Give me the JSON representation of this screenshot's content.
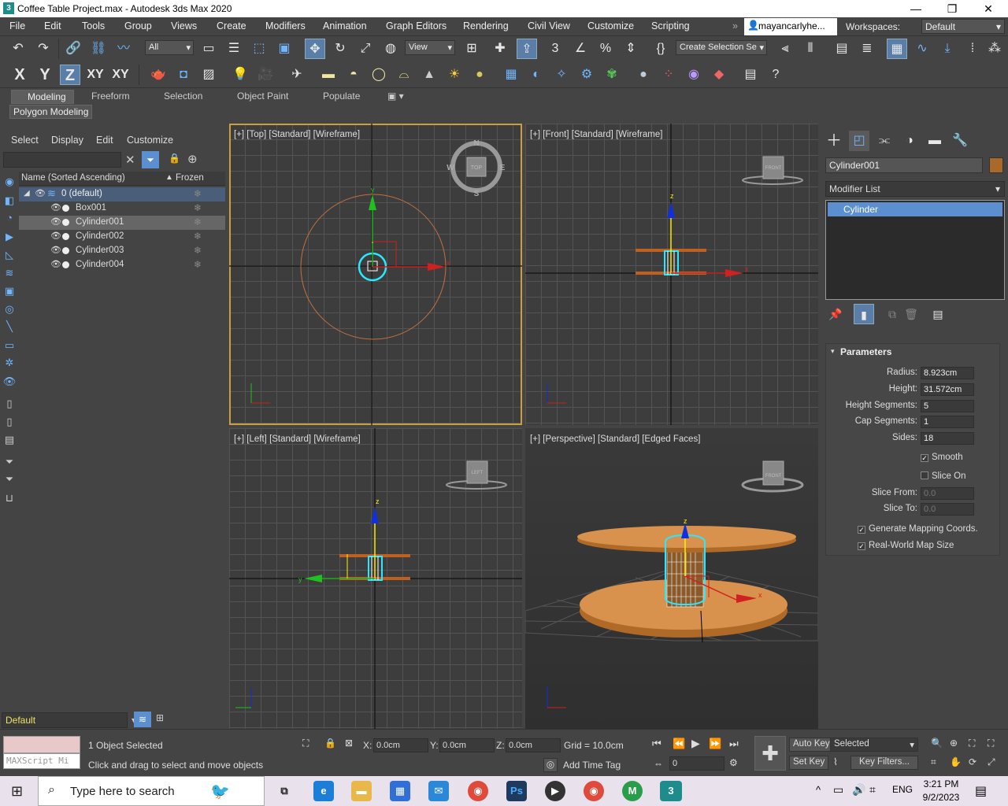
{
  "window": {
    "title": "Coffee Table Project.max - Autodesk 3ds Max 2020",
    "app_icon": "3"
  },
  "menu": [
    "File",
    "Edit",
    "Tools",
    "Group",
    "Views",
    "Create",
    "Modifiers",
    "Animation",
    "Graph Editors",
    "Rendering",
    "Civil View",
    "Customize",
    "Scripting"
  ],
  "user": {
    "name": "mayancarlyhe..."
  },
  "workspaces": {
    "label": "Workspaces:",
    "value": "Default"
  },
  "toolbar": {
    "selection_filter": "All",
    "ref_coord": "View",
    "named_selection": "Create Selection Se",
    "axes": [
      "X",
      "Y",
      "Z",
      "XY",
      "XY"
    ]
  },
  "ribbon": {
    "tabs": [
      "Modeling",
      "Freeform",
      "Selection",
      "Object Paint",
      "Populate"
    ],
    "sub": "Polygon Modeling"
  },
  "explorer": {
    "menu": [
      "Select",
      "Display",
      "Edit",
      "Customize"
    ],
    "col_name": "Name (Sorted Ascending)",
    "col_frozen": "Frozen",
    "layer": "0 (default)",
    "objects": [
      "Box001",
      "Cylinder001",
      "Cylinder002",
      "Cylinder003",
      "Cylinder004"
    ],
    "selected": "Cylinder001",
    "layer_dropdown": "Default"
  },
  "viewports": {
    "top": "[+] [Top] [Standard] [Wireframe]",
    "front": "[+] [Front] [Standard] [Wireframe]",
    "left": "[+] [Left] [Standard] [Wireframe]",
    "perspective": "[+] [Perspective] [Standard] [Edged Faces]",
    "cube_top": "TOP",
    "cube_front": "FRONT",
    "cube_left": "LEFT",
    "compass": [
      "N",
      "E",
      "S",
      "W"
    ],
    "axis_labels": {
      "x": "x",
      "y": "y",
      "z": "z"
    }
  },
  "command_panel": {
    "object_name": "Cylinder001",
    "modifier_list": "Modifier List",
    "stack_item": "Cylinder",
    "rollout": "Parameters",
    "params": [
      {
        "label": "Radius:",
        "value": "8.923cm"
      },
      {
        "label": "Height:",
        "value": "31.572cm"
      },
      {
        "label": "Height Segments:",
        "value": "5"
      },
      {
        "label": "Cap Segments:",
        "value": "1"
      },
      {
        "label": "Sides:",
        "value": "18"
      }
    ],
    "smooth": "Smooth",
    "slice_on": "Slice On",
    "slice_from": {
      "label": "Slice From:",
      "value": "0.0"
    },
    "slice_to": {
      "label": "Slice To:",
      "value": "0.0"
    },
    "gen_mapping": "Generate Mapping Coords.",
    "real_world": "Real-World Map Size"
  },
  "status": {
    "selected": "1 Object Selected",
    "prompt": "Click and drag to select and move objects",
    "maxscript": "MAXScript Mi",
    "x": "0.0cm",
    "y": "0.0cm",
    "z": "0.0cm",
    "x_label": "X:",
    "y_label": "Y:",
    "z_label": "Z:",
    "grid": "Grid = 10.0cm",
    "add_time_tag": "Add Time Tag",
    "frame": "0",
    "auto_key": "Auto Key",
    "set_key": "Set Key",
    "selected_drop": "Selected",
    "key_filters": "Key Filters..."
  },
  "taskbar": {
    "search_placeholder": "Type here to search",
    "lang": "ENG",
    "time": "3:21 PM",
    "date": "9/2/2023"
  }
}
